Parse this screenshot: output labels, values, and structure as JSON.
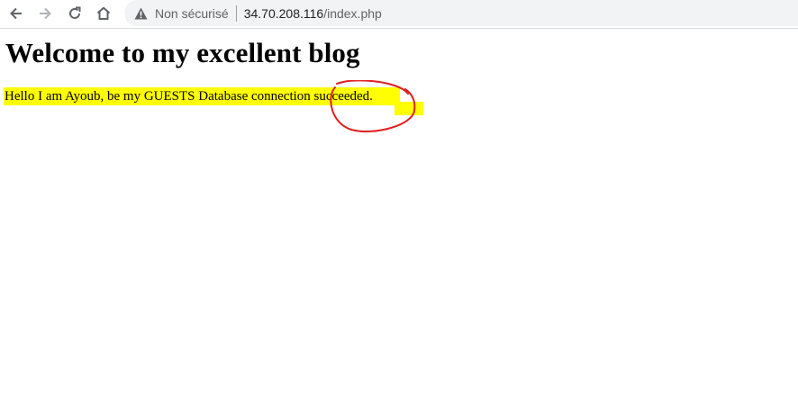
{
  "browser": {
    "security_label": "Non sécurisé",
    "url_host": "34.70.208.116",
    "url_path": "/index.php",
    "icons": {
      "back": "arrow-left-icon",
      "forward": "arrow-right-icon",
      "reload": "reload-icon",
      "home": "home-icon",
      "warning": "warning-triangle-icon"
    }
  },
  "page": {
    "heading": "Welcome to my excellent blog",
    "body_text": "Hello I am Ayoub, be my GUESTS Database connection succeeded."
  },
  "annotation": {
    "highlight_color": "#ffff00",
    "circle_color": "#e02020"
  }
}
